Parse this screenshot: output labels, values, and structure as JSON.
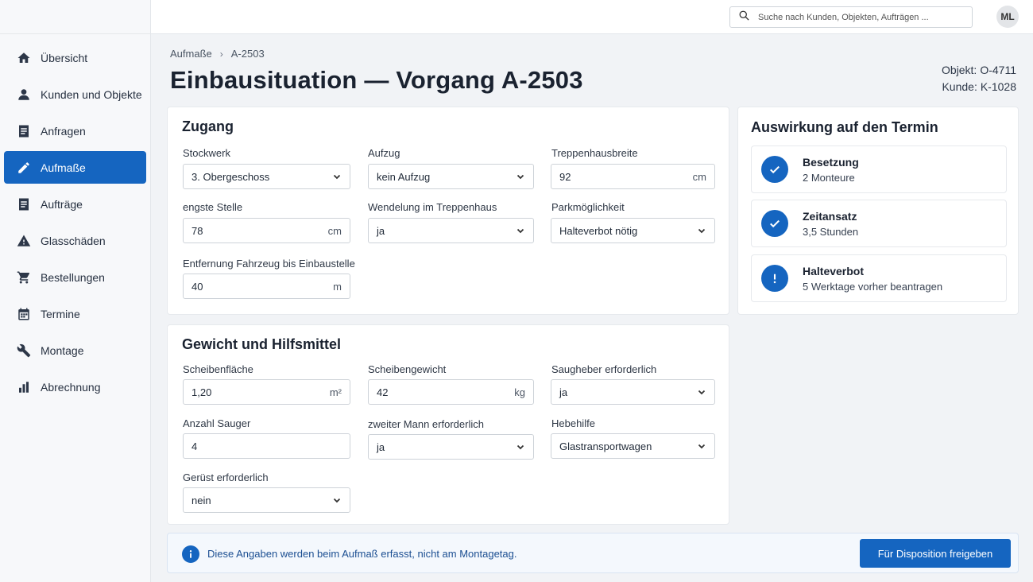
{
  "sidebar": {
    "items": [
      {
        "label": "Übersicht",
        "icon": "home-icon"
      },
      {
        "label": "Kunden und Objekte",
        "icon": "person-icon"
      },
      {
        "label": "Anfragen",
        "icon": "document-icon"
      },
      {
        "label": "Aufmaße",
        "icon": "pencil-icon",
        "active": true
      },
      {
        "label": "Aufträge",
        "icon": "document-icon"
      },
      {
        "label": "Glasschäden",
        "icon": "warning-icon"
      },
      {
        "label": "Bestellungen",
        "icon": "cart-icon"
      },
      {
        "label": "Termine",
        "icon": "calendar-icon"
      },
      {
        "label": "Montage",
        "icon": "wrench-icon"
      },
      {
        "label": "Abrechnung",
        "icon": "bar-chart-icon"
      }
    ]
  },
  "topbar": {
    "search_placeholder": "Suche nach Kunden, Objekten, Aufträgen ...",
    "avatar_initials": "ML"
  },
  "header": {
    "breadcrumb": [
      "Aufmaße",
      "A-2503"
    ],
    "title": "Einbausituation — Vorgang A-2503",
    "objekt_label": "Objekt:",
    "objekt_value": "O-4711",
    "kunde_label": "Kunde:",
    "kunde_value": "K-1028"
  },
  "zugang": {
    "title": "Zugang",
    "stockwerk": {
      "label": "Stockwerk",
      "value": "3. Obergeschoss"
    },
    "aufzug": {
      "label": "Aufzug",
      "value": "kein Aufzug"
    },
    "treppenhausbreite": {
      "label": "Treppenhausbreite",
      "value": "92",
      "unit": "cm"
    },
    "engste_stelle": {
      "label": "engste Stelle",
      "value": "78",
      "unit": "cm"
    },
    "wendelung": {
      "label": "Wendelung im Treppenhaus",
      "value": "ja"
    },
    "parkmoeglichkeit": {
      "label": "Parkmöglichkeit",
      "value": "Halteverbot nötig"
    },
    "entfernung": {
      "label": "Entfernung Fahrzeug bis Einbaustelle",
      "value": "40",
      "unit": "m"
    }
  },
  "gewicht": {
    "title": "Gewicht und Hilfsmittel",
    "scheibenflaeche": {
      "label": "Scheibenfläche",
      "value": "1,20",
      "unit": "m²"
    },
    "scheibengewicht": {
      "label": "Scheibengewicht",
      "value": "42",
      "unit": "kg"
    },
    "saugheber": {
      "label": "Saugheber erforderlich",
      "value": "ja"
    },
    "anzahl_sauger": {
      "label": "Anzahl Sauger",
      "value": "4"
    },
    "zweiter_mann": {
      "label": "zweiter Mann erforderlich",
      "value": "ja"
    },
    "hebehilfe": {
      "label": "Hebehilfe",
      "value": "Glastransportwagen"
    },
    "geruest": {
      "label": "Gerüst erforderlich",
      "value": "nein"
    }
  },
  "auswirkung": {
    "title": "Auswirkung auf den Termin",
    "items": [
      {
        "title": "Besetzung",
        "text": "2 Monteure",
        "icon": "check-icon"
      },
      {
        "title": "Zeitansatz",
        "text": "3,5 Stunden",
        "icon": "check-icon"
      },
      {
        "title": "Halteverbot",
        "text": "5 Werktage vorher beantragen",
        "icon": "exclamation-icon"
      }
    ]
  },
  "footer": {
    "info_text": "Diese Angaben werden beim Aufmaß erfasst, nicht am Montagetag.",
    "button_label": "Für Disposition freigeben"
  },
  "colors": {
    "accent": "#1565c0",
    "background": "#f1f3f6",
    "card": "#ffffff"
  }
}
